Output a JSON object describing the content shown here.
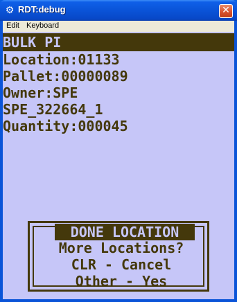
{
  "window": {
    "title": "RDT:debug",
    "app_icon": "app-icon",
    "close_glyph": "✕"
  },
  "menu": {
    "items": [
      "Edit",
      "Keyboard"
    ]
  },
  "screen": {
    "header": "BULK PI",
    "lines": [
      "Location:01133",
      "Pallet:00000089",
      "Owner:SPE",
      "SPE_322664_1",
      "Quantity:000045"
    ]
  },
  "dialog": {
    "title": "DONE LOCATION",
    "lines": [
      "More Locations?",
      "CLR - Cancel",
      "Other - Yes"
    ]
  },
  "colors": {
    "screen_bg": "#C6C6F8",
    "screen_fg": "#44380B",
    "titlebar": "#0A54D8"
  }
}
